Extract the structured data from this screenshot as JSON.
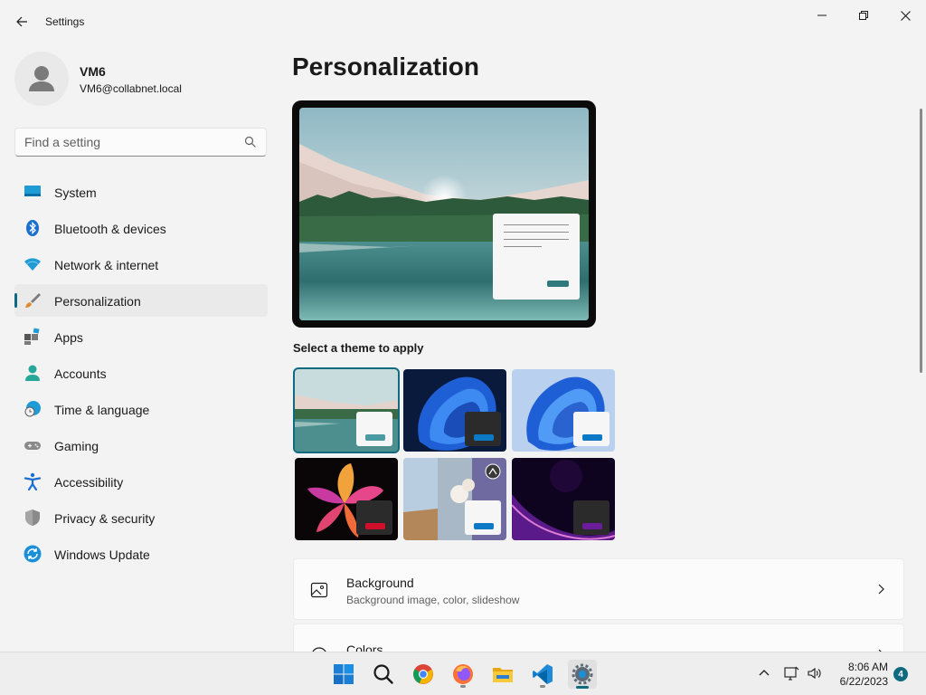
{
  "app": {
    "title": "Settings"
  },
  "window": {
    "minimize_label": "Minimize",
    "restore_label": "Restore",
    "close_label": "Close"
  },
  "profile": {
    "name": "VM6",
    "email": "VM6@collabnet.local"
  },
  "search": {
    "placeholder": "Find a setting"
  },
  "sidebar": {
    "items": [
      {
        "label": "System",
        "icon": "system-icon"
      },
      {
        "label": "Bluetooth & devices",
        "icon": "bluetooth-icon"
      },
      {
        "label": "Network & internet",
        "icon": "network-icon"
      },
      {
        "label": "Personalization",
        "icon": "personalization-icon",
        "active": true
      },
      {
        "label": "Apps",
        "icon": "apps-icon"
      },
      {
        "label": "Accounts",
        "icon": "accounts-icon"
      },
      {
        "label": "Time & language",
        "icon": "time-language-icon"
      },
      {
        "label": "Gaming",
        "icon": "gaming-icon"
      },
      {
        "label": "Accessibility",
        "icon": "accessibility-icon"
      },
      {
        "label": "Privacy & security",
        "icon": "shield-icon"
      },
      {
        "label": "Windows Update",
        "icon": "windows-update-icon"
      }
    ]
  },
  "main": {
    "title": "Personalization",
    "themes_label": "Select a theme to apply",
    "themes": [
      {
        "name": "lake",
        "accent": "#4a9aa3",
        "selected": true
      },
      {
        "name": "bloom-dark",
        "accent": "#0b79c6"
      },
      {
        "name": "bloom-light",
        "accent": "#0b79c6"
      },
      {
        "name": "flower",
        "accent": "#d0102a"
      },
      {
        "name": "spotlight",
        "accent": "#0b79c6"
      },
      {
        "name": "glow",
        "accent": "#6a1c9a"
      }
    ],
    "cards": [
      {
        "title": "Background",
        "subtitle": "Background image, color, slideshow",
        "icon": "image-icon"
      },
      {
        "title": "Colors",
        "subtitle": "",
        "icon": "palette-icon"
      }
    ]
  },
  "taskbar": {
    "apps": [
      {
        "name": "start",
        "icon": "windows-logo-icon"
      },
      {
        "name": "search",
        "icon": "search-icon"
      },
      {
        "name": "chrome",
        "icon": "chrome-icon"
      },
      {
        "name": "firefox",
        "icon": "firefox-icon"
      },
      {
        "name": "file-explorer",
        "icon": "folder-icon"
      },
      {
        "name": "vscode",
        "icon": "vscode-icon"
      },
      {
        "name": "settings",
        "icon": "gear-icon",
        "active": true
      }
    ],
    "time": "8:06 AM",
    "date": "6/22/2023",
    "notifications": "4"
  },
  "colors": {
    "accent": "#0f6a80",
    "window_bg": "#f3f3f3",
    "card_bg": "#fbfbfb"
  }
}
